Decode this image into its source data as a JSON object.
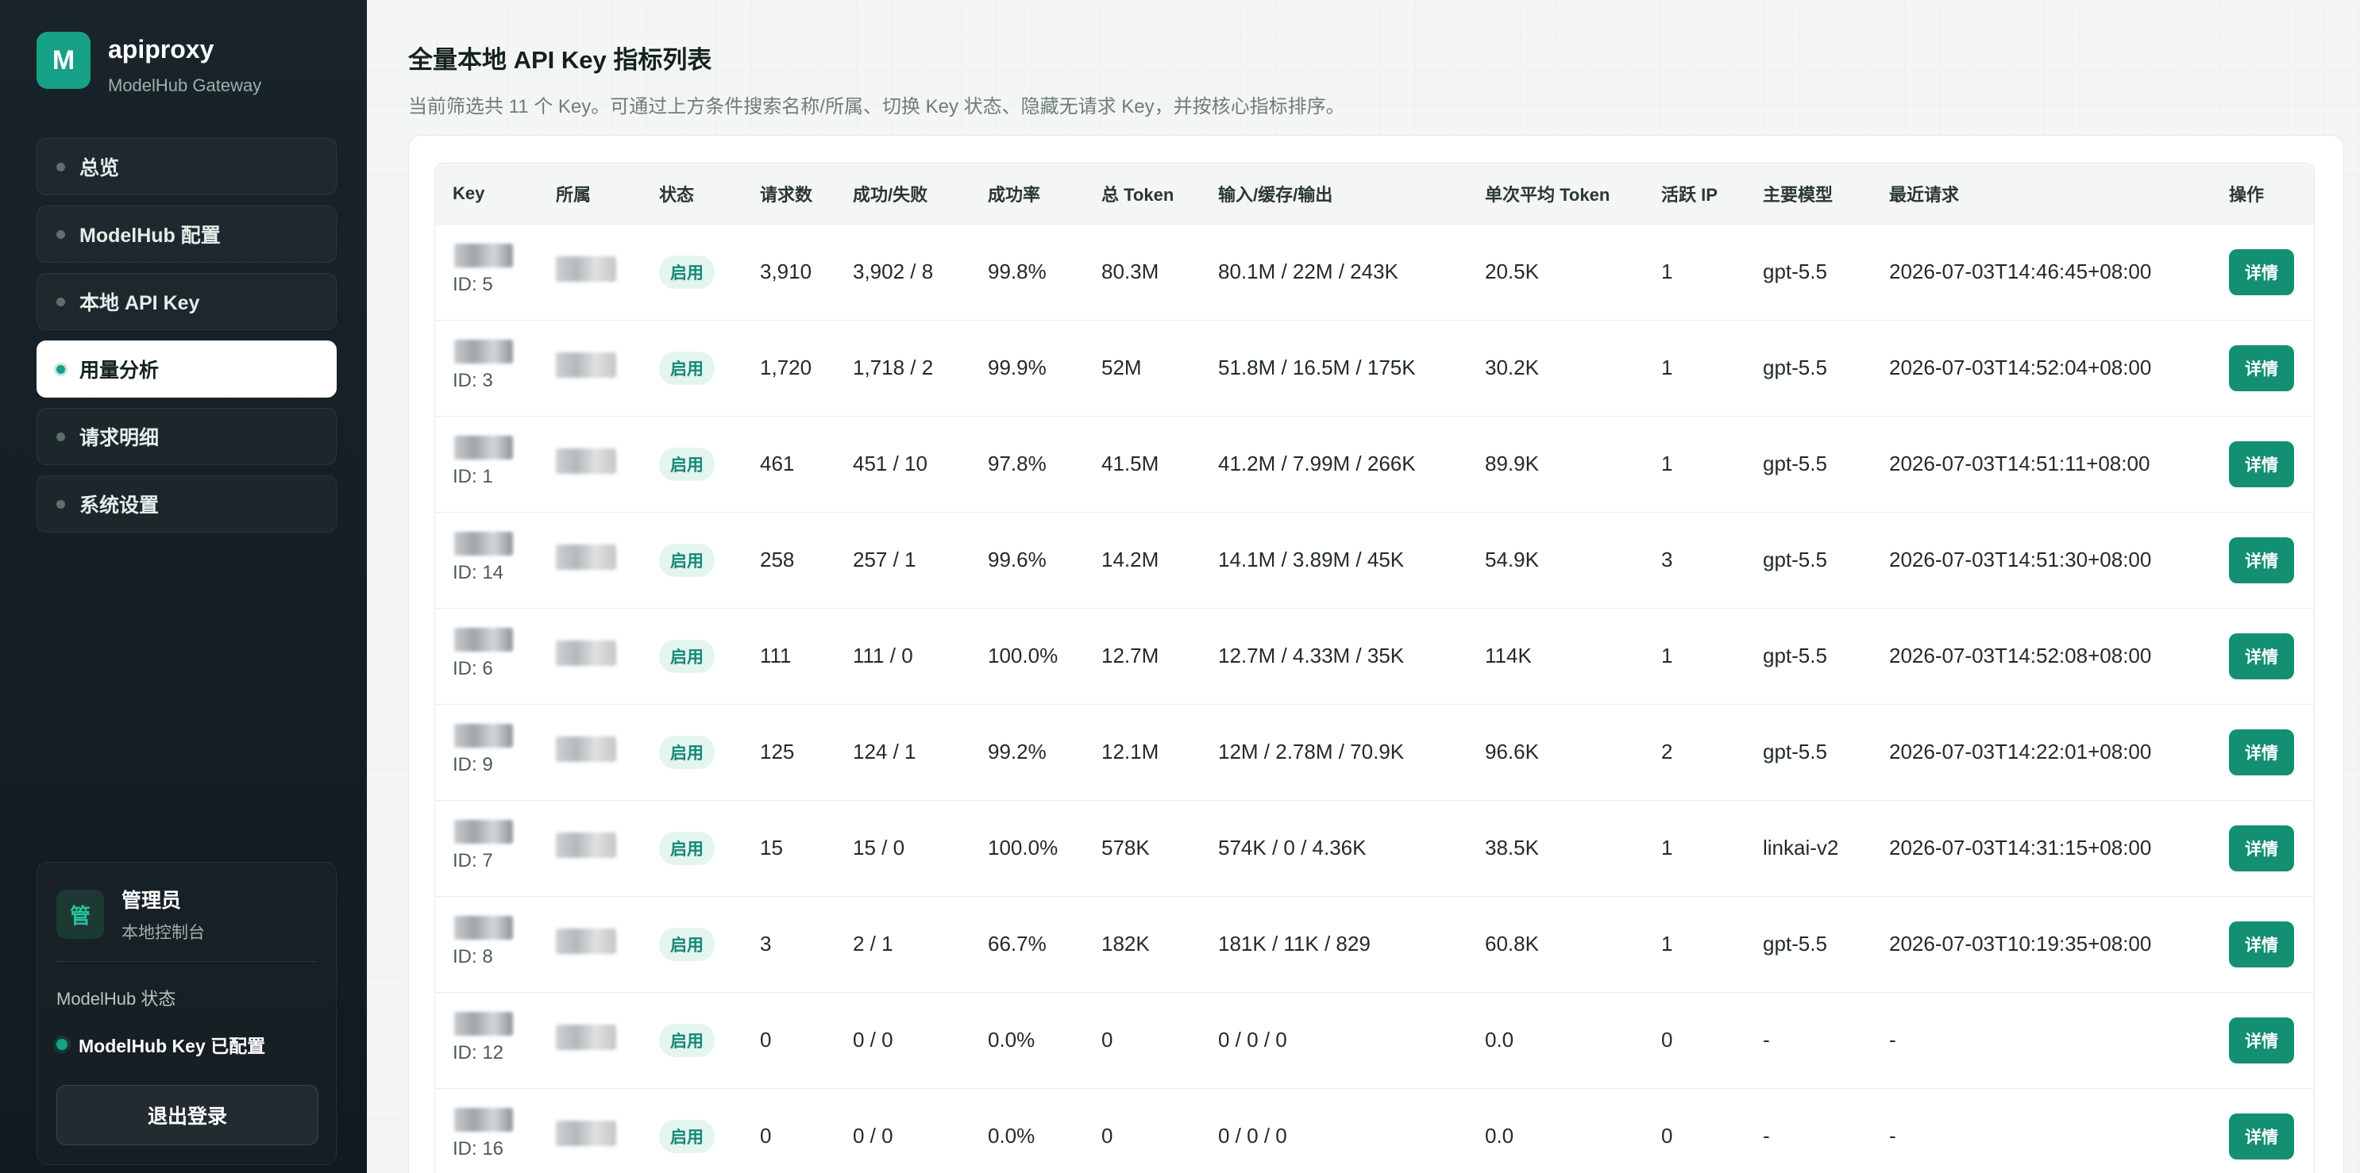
{
  "brand": {
    "logo_letter": "M",
    "name": "apiproxy",
    "subtitle": "ModelHub Gateway"
  },
  "nav": [
    {
      "label": "总览",
      "active": false
    },
    {
      "label": "ModelHub 配置",
      "active": false
    },
    {
      "label": "本地 API Key",
      "active": false
    },
    {
      "label": "用量分析",
      "active": true
    },
    {
      "label": "请求明细",
      "active": false
    },
    {
      "label": "系统设置",
      "active": false
    }
  ],
  "user": {
    "avatar": "管",
    "name": "管理员",
    "role": "本地控制台",
    "modelhub_label": "ModelHub 状态",
    "modelhub_status": "ModelHub Key 已配置",
    "logout_label": "退出登录"
  },
  "page": {
    "title": "全量本地 API Key 指标列表",
    "subtitle": "当前筛选共 11 个 Key。可通过上方条件搜索名称/所属、切换 Key 状态、隐藏无请求 Key，并按核心指标排序。"
  },
  "table": {
    "columns": [
      "Key",
      "所属",
      "状态",
      "请求数",
      "成功/失败",
      "成功率",
      "总 Token",
      "输入/缓存/输出",
      "单次平均 Token",
      "活跃 IP",
      "主要模型",
      "最近请求",
      "操作"
    ],
    "rows": [
      {
        "id": "ID: 5",
        "status": "启用",
        "requests": "3,910",
        "success_fail": "3,902 / 8",
        "rate": "99.8%",
        "tokens": "80.3M",
        "io": "80.1M / 22M / 243K",
        "avg": "20.5K",
        "ips": "1",
        "model": "gpt-5.5",
        "last": "2026-07-03T14:46:45+08:00",
        "action": "详情"
      },
      {
        "id": "ID: 3",
        "status": "启用",
        "requests": "1,720",
        "success_fail": "1,718 / 2",
        "rate": "99.9%",
        "tokens": "52M",
        "io": "51.8M / 16.5M / 175K",
        "avg": "30.2K",
        "ips": "1",
        "model": "gpt-5.5",
        "last": "2026-07-03T14:52:04+08:00",
        "action": "详情"
      },
      {
        "id": "ID: 1",
        "status": "启用",
        "requests": "461",
        "success_fail": "451 / 10",
        "rate": "97.8%",
        "tokens": "41.5M",
        "io": "41.2M / 7.99M / 266K",
        "avg": "89.9K",
        "ips": "1",
        "model": "gpt-5.5",
        "last": "2026-07-03T14:51:11+08:00",
        "action": "详情"
      },
      {
        "id": "ID: 14",
        "status": "启用",
        "requests": "258",
        "success_fail": "257 / 1",
        "rate": "99.6%",
        "tokens": "14.2M",
        "io": "14.1M / 3.89M / 45K",
        "avg": "54.9K",
        "ips": "3",
        "model": "gpt-5.5",
        "last": "2026-07-03T14:51:30+08:00",
        "action": "详情"
      },
      {
        "id": "ID: 6",
        "status": "启用",
        "requests": "111",
        "success_fail": "111 / 0",
        "rate": "100.0%",
        "tokens": "12.7M",
        "io": "12.7M / 4.33M / 35K",
        "avg": "114K",
        "ips": "1",
        "model": "gpt-5.5",
        "last": "2026-07-03T14:52:08+08:00",
        "action": "详情"
      },
      {
        "id": "ID: 9",
        "status": "启用",
        "requests": "125",
        "success_fail": "124 / 1",
        "rate": "99.2%",
        "tokens": "12.1M",
        "io": "12M / 2.78M / 70.9K",
        "avg": "96.6K",
        "ips": "2",
        "model": "gpt-5.5",
        "last": "2026-07-03T14:22:01+08:00",
        "action": "详情"
      },
      {
        "id": "ID: 7",
        "status": "启用",
        "requests": "15",
        "success_fail": "15 / 0",
        "rate": "100.0%",
        "tokens": "578K",
        "io": "574K / 0 / 4.36K",
        "avg": "38.5K",
        "ips": "1",
        "model": "linkai-v2",
        "last": "2026-07-03T14:31:15+08:00",
        "action": "详情"
      },
      {
        "id": "ID: 8",
        "status": "启用",
        "requests": "3",
        "success_fail": "2 / 1",
        "rate": "66.7%",
        "tokens": "182K",
        "io": "181K / 11K / 829",
        "avg": "60.8K",
        "ips": "1",
        "model": "gpt-5.5",
        "last": "2026-07-03T10:19:35+08:00",
        "action": "详情"
      },
      {
        "id": "ID: 12",
        "status": "启用",
        "requests": "0",
        "success_fail": "0 / 0",
        "rate": "0.0%",
        "tokens": "0",
        "io": "0 / 0 / 0",
        "avg": "0.0",
        "ips": "0",
        "model": "-",
        "last": "-",
        "action": "详情"
      },
      {
        "id": "ID: 16",
        "status": "启用",
        "requests": "0",
        "success_fail": "0 / 0",
        "rate": "0.0%",
        "tokens": "0",
        "io": "0 / 0 / 0",
        "avg": "0.0",
        "ips": "0",
        "model": "-",
        "last": "-",
        "action": "详情"
      }
    ]
  }
}
